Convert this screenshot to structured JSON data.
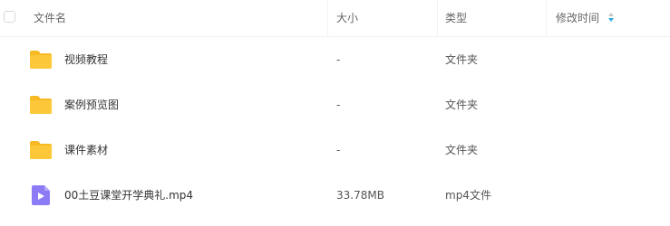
{
  "header": {
    "name": "文件名",
    "size": "大小",
    "type": "类型",
    "modified": "修改时间"
  },
  "files": [
    {
      "name": "视频教程",
      "size": "-",
      "type": "文件夹",
      "icon": "folder-icon"
    },
    {
      "name": "案例预览图",
      "size": "-",
      "type": "文件夹",
      "icon": "folder-icon"
    },
    {
      "name": "课件素材",
      "size": "-",
      "type": "文件夹",
      "icon": "folder-icon"
    },
    {
      "name": "00土豆课堂开学典礼.mp4",
      "size": "33.78MB",
      "type": "mp4文件",
      "icon": "video-file-icon"
    }
  ],
  "colors": {
    "folder": "#f9c231",
    "video": "#8b7cf6",
    "sort_active": "#29a8e0"
  }
}
